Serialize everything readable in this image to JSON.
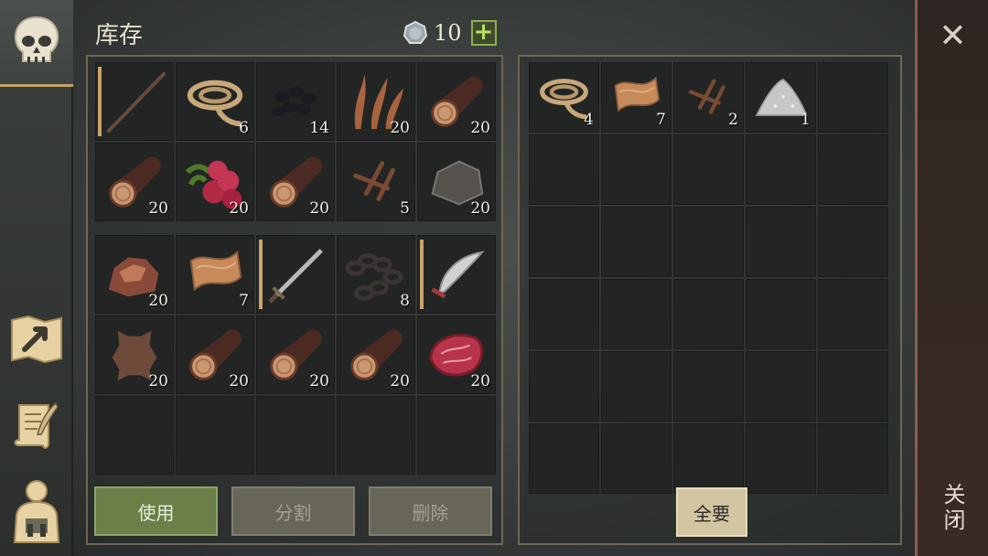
{
  "title": "库存",
  "currency": {
    "amount": "10",
    "add_label": "+"
  },
  "buttons": {
    "use": "使用",
    "split": "分割",
    "delete": "删除",
    "take_all": "全要"
  },
  "close_label": "关闭",
  "inventory_top": [
    {
      "item": "stick",
      "count": ""
    },
    {
      "item": "rope",
      "count": "6"
    },
    {
      "item": "coal",
      "count": "14"
    },
    {
      "item": "plant-fiber",
      "count": "20"
    },
    {
      "item": "log",
      "count": "20"
    },
    {
      "item": "log",
      "count": "20"
    },
    {
      "item": "berries",
      "count": "20"
    },
    {
      "item": "log",
      "count": "20"
    },
    {
      "item": "nails",
      "count": "5"
    },
    {
      "item": "stone",
      "count": "20"
    }
  ],
  "inventory_bottom": [
    {
      "item": "iron-ore",
      "count": "20"
    },
    {
      "item": "cloth",
      "count": "7"
    },
    {
      "item": "sword",
      "count": ""
    },
    {
      "item": "chain",
      "count": "8"
    },
    {
      "item": "scimitar",
      "count": ""
    },
    {
      "item": "leather",
      "count": "20"
    },
    {
      "item": "log",
      "count": "20"
    },
    {
      "item": "log",
      "count": "20"
    },
    {
      "item": "log",
      "count": "20"
    },
    {
      "item": "raw-meat",
      "count": "20"
    },
    {
      "item": "",
      "count": ""
    },
    {
      "item": "",
      "count": ""
    },
    {
      "item": "",
      "count": ""
    },
    {
      "item": "",
      "count": ""
    },
    {
      "item": "",
      "count": ""
    }
  ],
  "loot": [
    {
      "item": "rope",
      "count": "4"
    },
    {
      "item": "cloth",
      "count": "7"
    },
    {
      "item": "nails",
      "count": "2"
    },
    {
      "item": "salt",
      "count": "1"
    }
  ]
}
